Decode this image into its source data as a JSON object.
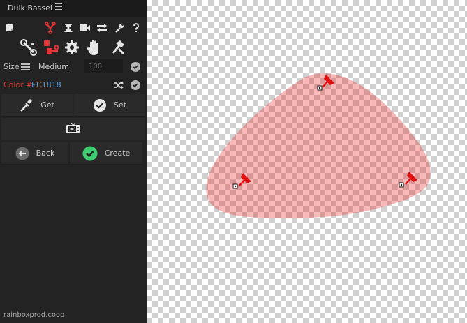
{
  "panel": {
    "title": "Duik Bassel",
    "size": {
      "label": "Size",
      "value": "Medium",
      "number": "100"
    },
    "color": {
      "label": "Color #",
      "value": "EC1818",
      "accent": "#EC1818"
    },
    "buttons": {
      "get": "Get",
      "set": "Set",
      "back": "Back",
      "create": "Create"
    },
    "footer": "rainboxprod.coop"
  },
  "icons": {
    "toolbar": [
      "note-icon",
      "bones-icon",
      "constraint-icon",
      "camera-icon",
      "swap-icon",
      "wrench-icon",
      "help-icon"
    ],
    "tools": [
      "bone-tool-icon",
      "active-bone-tool-icon",
      "gear-icon",
      "hand-icon",
      "hammer-icon"
    ]
  },
  "canvas": {
    "shape_color": "#EC1818",
    "shape_opacity": 0.3,
    "pins": [
      "pin-top",
      "pin-left",
      "pin-right"
    ]
  }
}
